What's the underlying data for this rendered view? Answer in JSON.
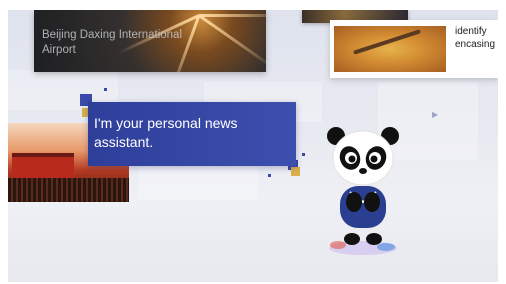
{
  "cards": {
    "airport_title": "Beijing Daxing International Airport",
    "snippet_text": "identify encasing"
  },
  "assistant": {
    "message": "I'm your personal news assistant."
  },
  "colors": {
    "panel": "#3a4aa8",
    "accent_gold": "#d9b04a",
    "panda_shirt": "#2a3f8f"
  },
  "icons": {
    "nav_arrow": "chevron-right-icon"
  }
}
